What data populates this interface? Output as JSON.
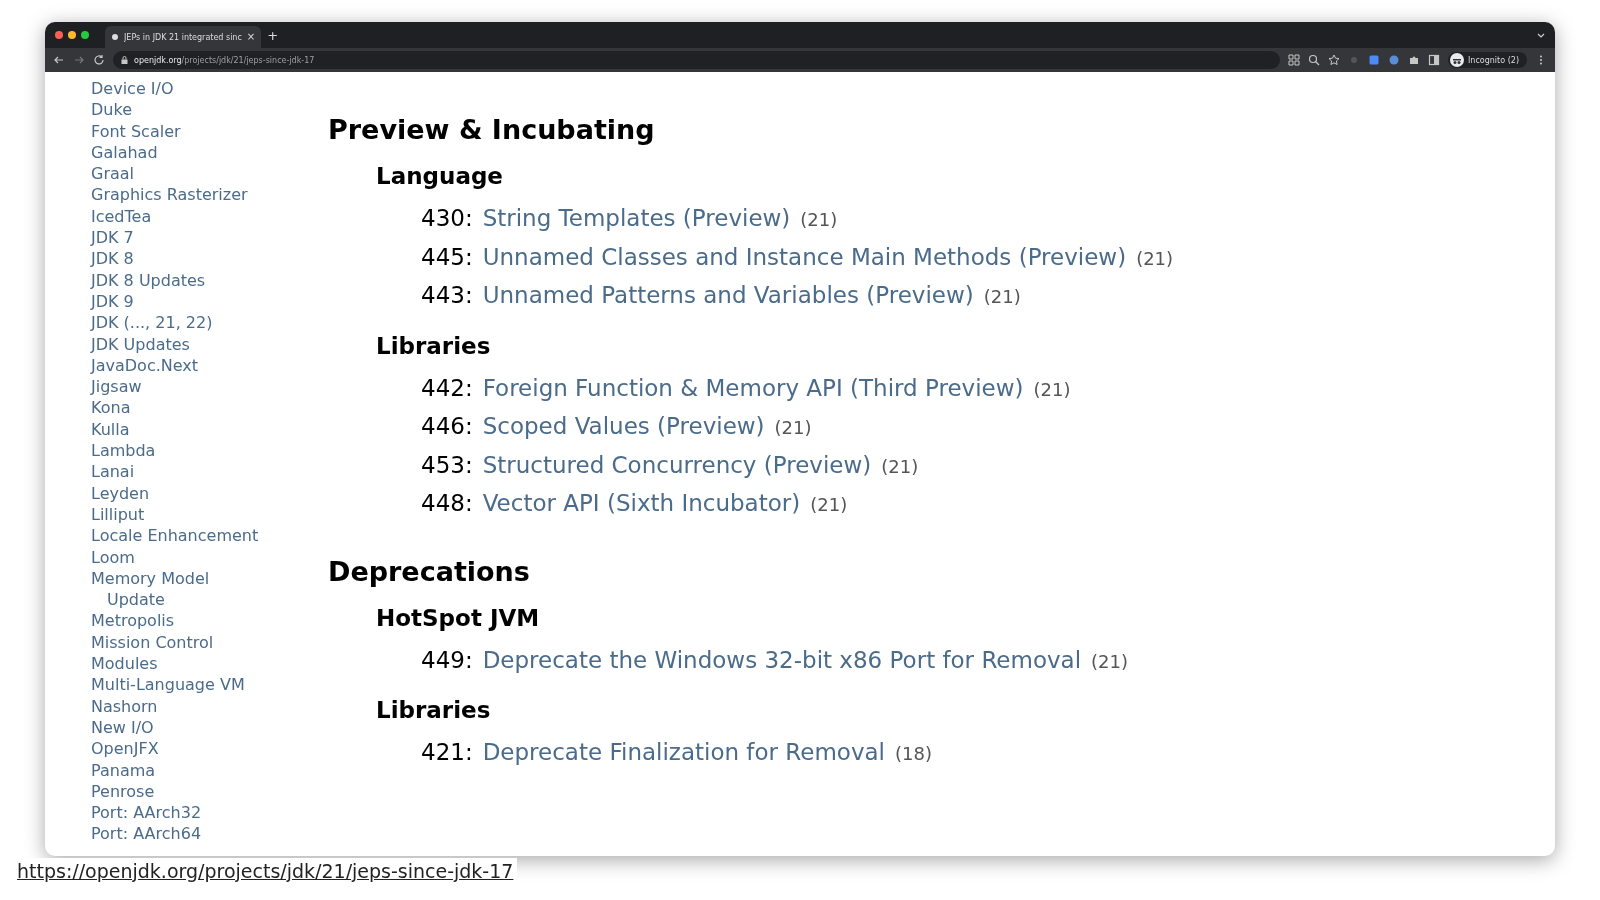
{
  "browser": {
    "tab": {
      "title": "JEPs in JDK 21 integrated sinc",
      "close": "×"
    },
    "new_tab": "+",
    "address": {
      "host": "openjdk.org",
      "path": "/projects/jdk/21/jeps-since-jdk-17"
    },
    "profile": "Incognito (2)"
  },
  "sidebar": {
    "items": [
      {
        "label": "Device I/O"
      },
      {
        "label": "Duke"
      },
      {
        "label": "Font Scaler"
      },
      {
        "label": "Galahad"
      },
      {
        "label": "Graal"
      },
      {
        "label": "Graphics Rasterizer"
      },
      {
        "label": "IcedTea"
      },
      {
        "label": "JDK 7"
      },
      {
        "label": "JDK 8"
      },
      {
        "label": "JDK 8 Updates"
      },
      {
        "label": "JDK 9"
      },
      {
        "label": "JDK (..., 21, 22)"
      },
      {
        "label": "JDK Updates"
      },
      {
        "label": "JavaDoc.Next"
      },
      {
        "label": "Jigsaw"
      },
      {
        "label": "Kona"
      },
      {
        "label": "Kulla"
      },
      {
        "label": "Lambda"
      },
      {
        "label": "Lanai"
      },
      {
        "label": "Leyden"
      },
      {
        "label": "Lilliput"
      },
      {
        "label": "Locale Enhancement"
      },
      {
        "label": "Loom"
      },
      {
        "label": "Memory Model Update",
        "wrap": true
      },
      {
        "label": "Metropolis"
      },
      {
        "label": "Mission Control"
      },
      {
        "label": "Modules"
      },
      {
        "label": "Multi-Language VM"
      },
      {
        "label": "Nashorn"
      },
      {
        "label": "New I/O"
      },
      {
        "label": "OpenJFX"
      },
      {
        "label": "Panama"
      },
      {
        "label": "Penrose"
      },
      {
        "label": "Port: AArch32"
      },
      {
        "label": "Port: AArch64"
      }
    ]
  },
  "sections": [
    {
      "title": "Preview & Incubating",
      "groups": [
        {
          "title": "Language",
          "jeps": [
            {
              "number": "430:",
              "title": "String Templates (Preview)",
              "release": "(21)"
            },
            {
              "number": "445:",
              "title": "Unnamed Classes and Instance Main Methods (Preview)",
              "release": "(21)"
            },
            {
              "number": "443:",
              "title": "Unnamed Patterns and Variables (Preview)",
              "release": "(21)"
            }
          ]
        },
        {
          "title": "Libraries",
          "jeps": [
            {
              "number": "442:",
              "title": "Foreign Function & Memory API (Third Preview)",
              "release": "(21)"
            },
            {
              "number": "446:",
              "title": "Scoped Values (Preview)",
              "release": "(21)"
            },
            {
              "number": "453:",
              "title": "Structured Concurrency (Preview)",
              "release": "(21)"
            },
            {
              "number": "448:",
              "title": "Vector API (Sixth Incubator)",
              "release": "(21)"
            }
          ]
        }
      ]
    },
    {
      "title": "Deprecations",
      "groups": [
        {
          "title": "HotSpot JVM",
          "jeps": [
            {
              "number": "449:",
              "title": "Deprecate the Windows 32-bit x86 Port for Removal",
              "release": "(21)"
            }
          ]
        },
        {
          "title": "Libraries",
          "jeps": [
            {
              "number": "421:",
              "title": "Deprecate Finalization for Removal",
              "release": "(18)"
            }
          ]
        }
      ]
    }
  ],
  "caption_link": "https://openjdk.org/projects/jdk/21/jeps-since-jdk-17"
}
